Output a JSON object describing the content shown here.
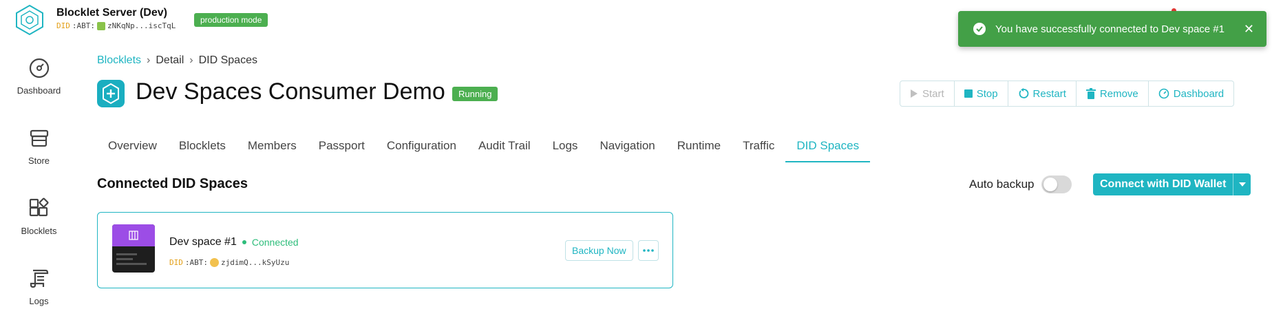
{
  "header": {
    "title": "Blocklet Server (Dev)",
    "did_prefix": "DID",
    "did_rest": ":ABT:",
    "did_value": "zNKqNp...iscTqL",
    "mode_badge": "production mode"
  },
  "toast": {
    "message": "You have successfully connected to Dev space #1",
    "close": "✕"
  },
  "sidebar": {
    "items": [
      {
        "label": "Dashboard",
        "icon": "dashboard-icon"
      },
      {
        "label": "Store",
        "icon": "store-icon"
      },
      {
        "label": "Blocklets",
        "icon": "blocklets-icon"
      },
      {
        "label": "Logs",
        "icon": "logs-icon"
      }
    ]
  },
  "breadcrumb": {
    "items": [
      "Blocklets",
      "Detail",
      "DID Spaces"
    ],
    "separator": "›"
  },
  "app": {
    "title": "Dev Spaces Consumer Demo",
    "status": "Running"
  },
  "actions": {
    "start": "Start",
    "stop": "Stop",
    "restart": "Restart",
    "remove": "Remove",
    "dashboard": "Dashboard"
  },
  "tabs": {
    "items": [
      "Overview",
      "Blocklets",
      "Members",
      "Passport",
      "Configuration",
      "Audit Trail",
      "Logs",
      "Navigation",
      "Runtime",
      "Traffic",
      "DID Spaces"
    ],
    "active": "DID Spaces"
  },
  "section": {
    "title": "Connected DID Spaces",
    "auto_backup_label": "Auto backup",
    "auto_backup_on": false,
    "connect_button": "Connect with DID Wallet"
  },
  "space": {
    "name": "Dev space #1",
    "status": "Connected",
    "did_prefix": "DID",
    "did_rest": ":ABT:",
    "did_value": "zjdimQ...kSyUzu",
    "backup_button": "Backup Now"
  },
  "colors": {
    "accent": "#1fb5c2",
    "success": "#43a047",
    "badge_green": "#4caf50",
    "connected": "#2ebd7b"
  }
}
